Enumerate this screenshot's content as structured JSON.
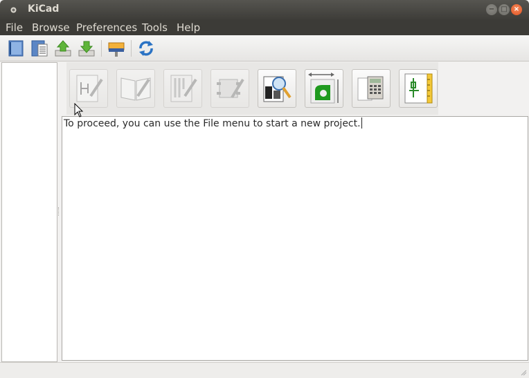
{
  "window": {
    "title": "KiCad",
    "buttons": [
      "minimize-icon",
      "maximize-icon",
      "close-icon"
    ]
  },
  "menubar": {
    "items": [
      "File",
      "Browse",
      "Preferences",
      "Tools",
      "Help"
    ]
  },
  "toolbar": {
    "buttons": [
      {
        "icon": "new-project-icon"
      },
      {
        "icon": "new-project-from-template-icon"
      },
      {
        "icon": "open-project-icon"
      },
      {
        "icon": "save-project-icon"
      },
      {
        "icon": "archive-project-icon"
      },
      {
        "icon": "refresh-icon"
      }
    ]
  },
  "launchers": [
    {
      "icon": "schematic-editor-icon",
      "enabled": false
    },
    {
      "icon": "schematic-library-editor-icon",
      "enabled": false
    },
    {
      "icon": "pcb-editor-icon",
      "enabled": false
    },
    {
      "icon": "footprint-editor-icon",
      "enabled": false
    },
    {
      "icon": "gerber-viewer-icon",
      "enabled": true
    },
    {
      "icon": "bitmap-converter-icon",
      "enabled": true
    },
    {
      "icon": "pcb-calculator-icon",
      "enabled": true
    },
    {
      "icon": "worksheet-editor-icon",
      "enabled": true
    }
  ],
  "message": {
    "text": "To proceed, you can use the File menu to start a new project."
  },
  "colors": {
    "titlebar": "#3c3b37",
    "close_button": "#e05220",
    "window_bg": "#f2f1f0"
  }
}
